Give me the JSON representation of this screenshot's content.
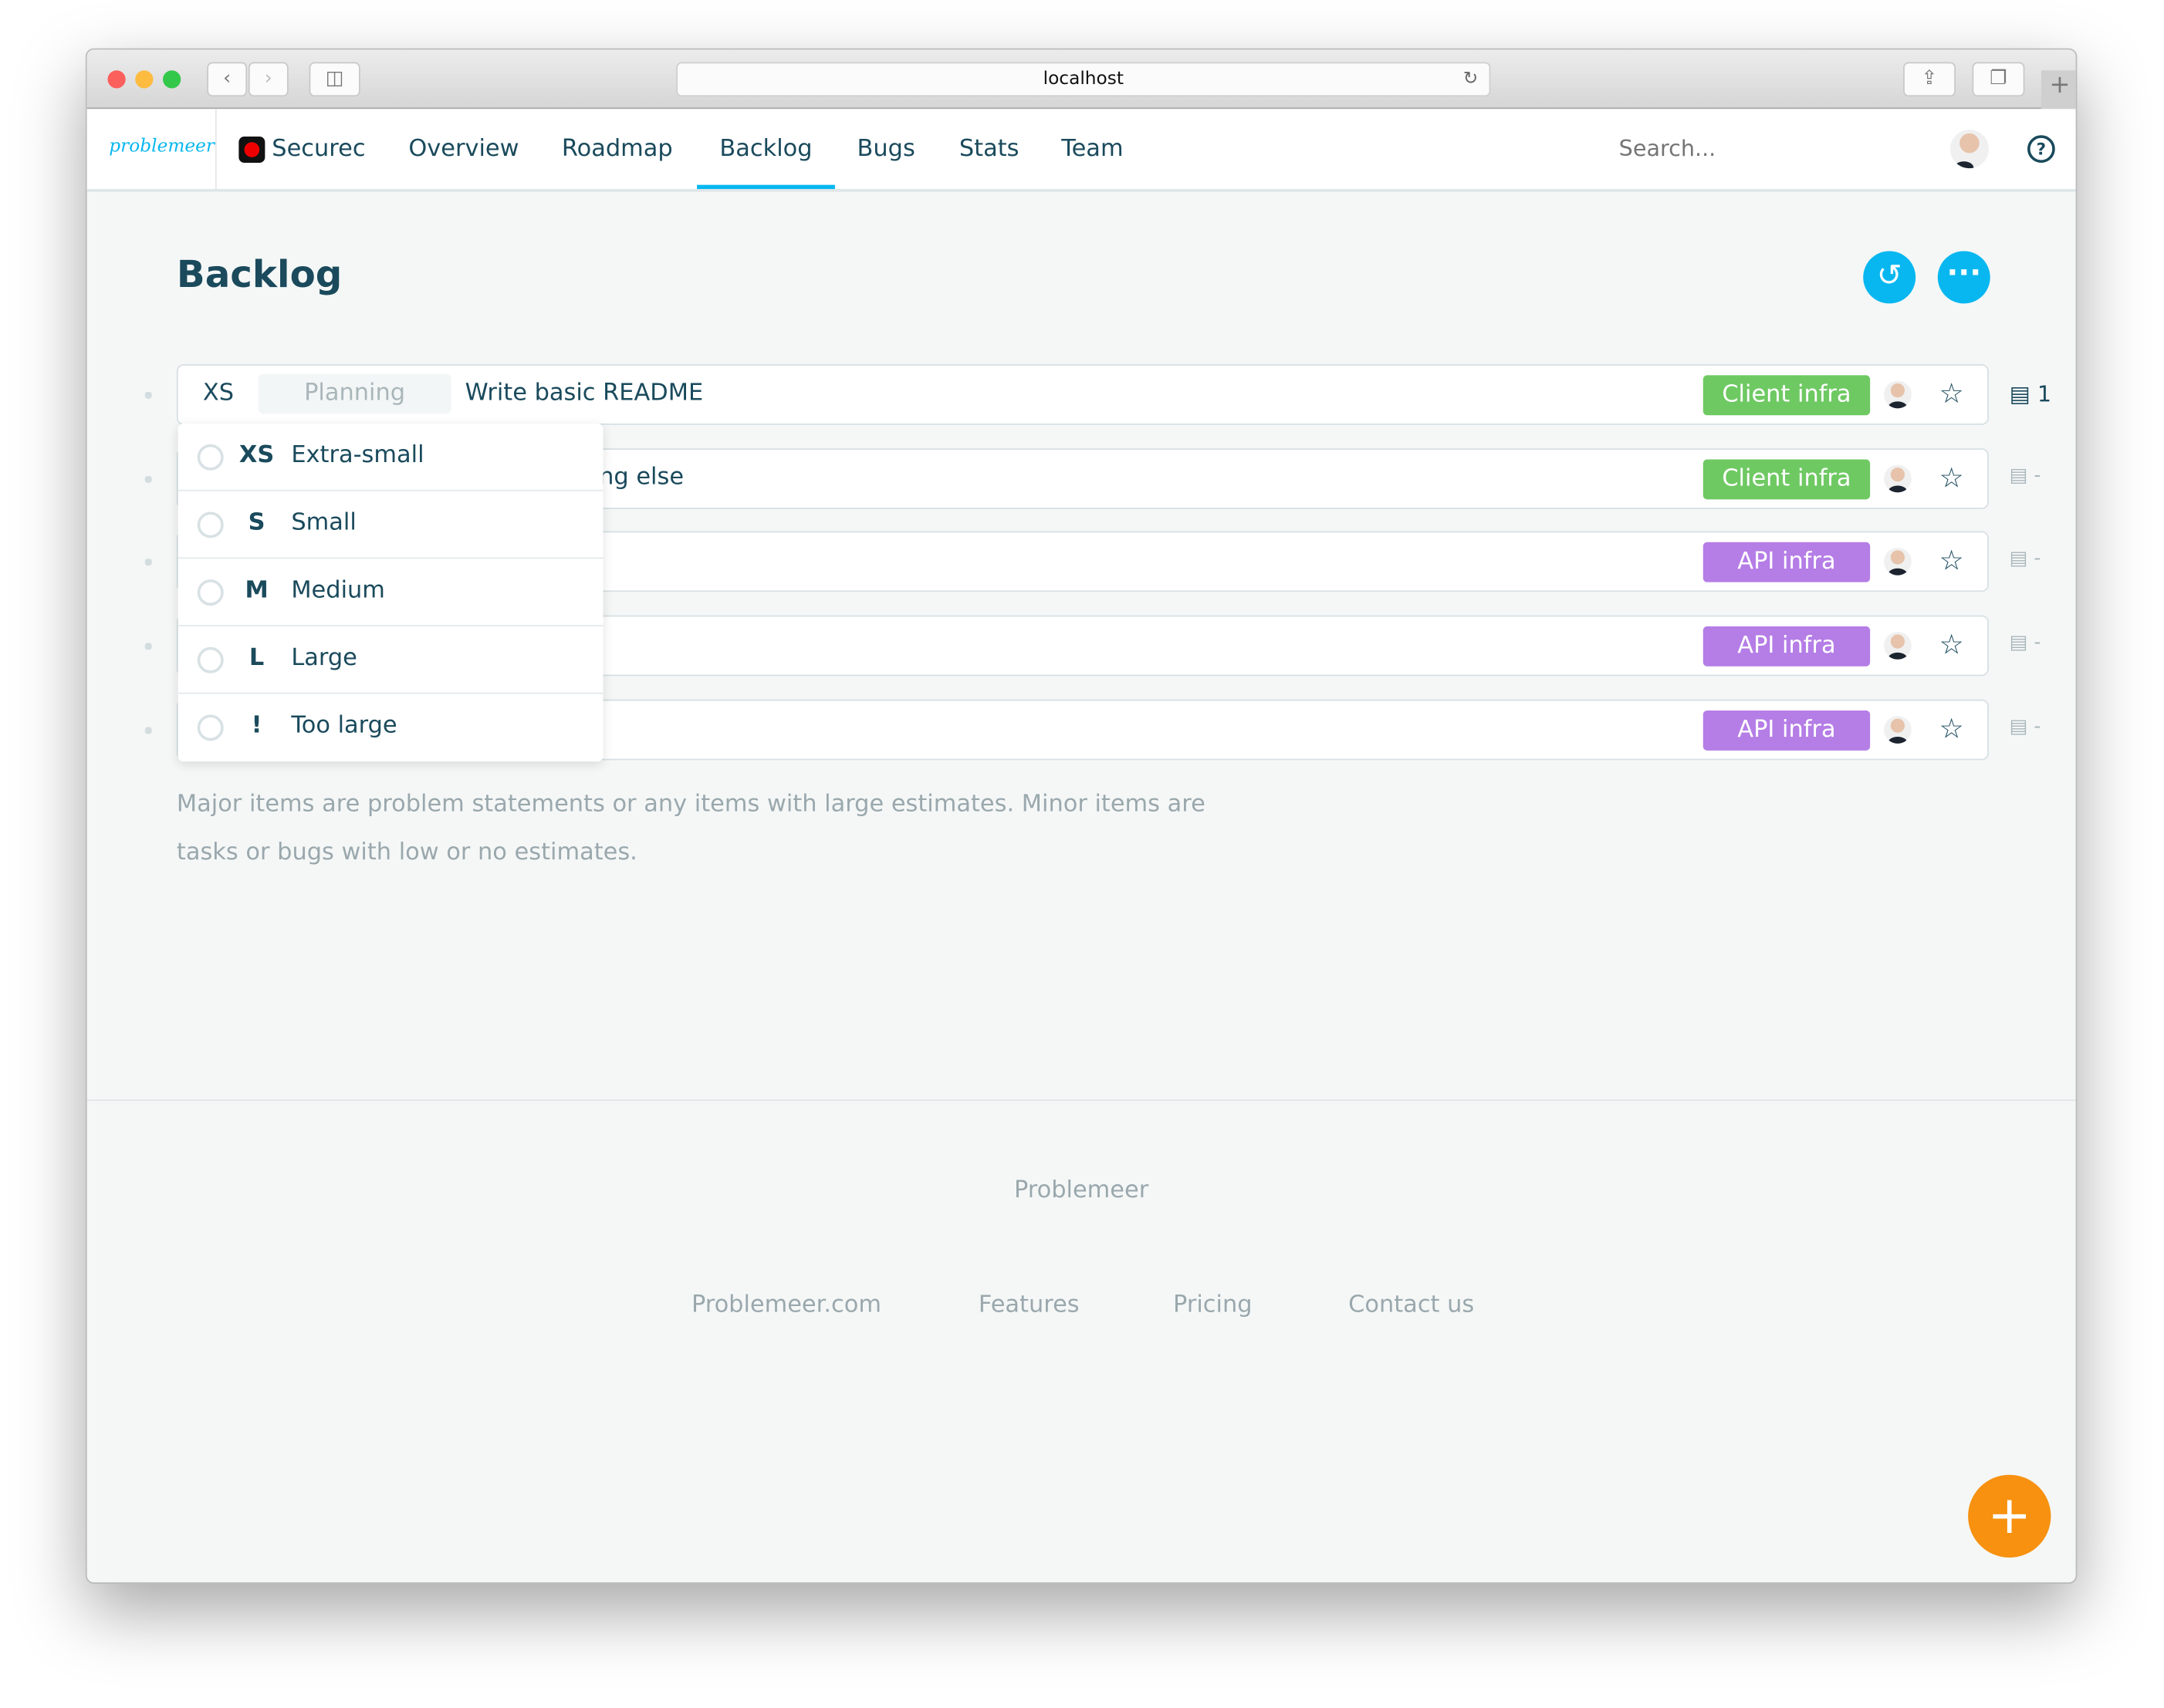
{
  "browser": {
    "url": "localhost"
  },
  "nav": {
    "logo": "problemeer",
    "project": "Securec",
    "items": [
      "Overview",
      "Roadmap",
      "Backlog",
      "Bugs",
      "Stats",
      "Team"
    ],
    "active": "Backlog",
    "search_placeholder": "Search..."
  },
  "page": {
    "title": "Backlog"
  },
  "rows": [
    {
      "size": "XS",
      "status": "Planning",
      "title": "Write basic README",
      "tag": "Client infra",
      "tag_color": "#6fc963",
      "comments": "1"
    },
    {
      "title_visible": "ng else",
      "tag": "Client infra",
      "tag_color": "#6fc963",
      "comments": "-"
    },
    {
      "tag": "API infra",
      "tag_color": "#b57de6",
      "comments": "-"
    },
    {
      "tag": "API infra",
      "tag_color": "#b57de6",
      "comments": "-"
    },
    {
      "tag": "API infra",
      "tag_color": "#b57de6",
      "comments": "-"
    }
  ],
  "size_menu": [
    {
      "code": "XS",
      "label": "Extra-small"
    },
    {
      "code": "S",
      "label": "Small"
    },
    {
      "code": "M",
      "label": "Medium"
    },
    {
      "code": "L",
      "label": "Large"
    },
    {
      "code": "!",
      "label": "Too large"
    }
  ],
  "note": {
    "line1": "Major items are problem statements or any items with large estimates. Minor items are",
    "line2": "tasks or bugs with low or no estimates."
  },
  "footer": {
    "brand": "Problemeer",
    "links": [
      "Problemeer.com",
      "Features",
      "Pricing",
      "Contact us"
    ]
  },
  "colors": {
    "accent": "#08b7f0",
    "fab": "#f7910f",
    "text": "#1a4a5c"
  }
}
